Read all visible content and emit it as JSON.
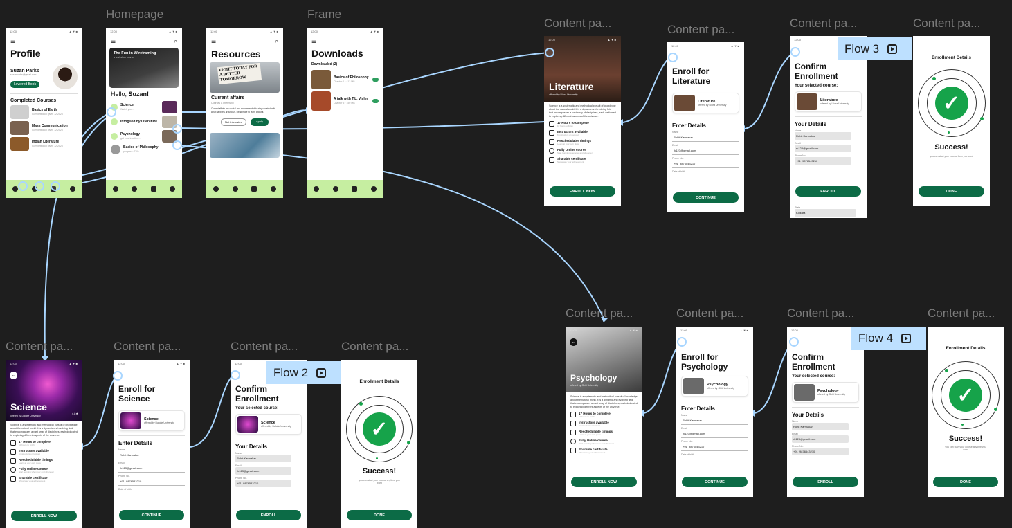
{
  "frame_labels": {
    "profile_label": "",
    "homepage": "Homepage",
    "resources_label": "",
    "frame": "Frame",
    "cp1": "Content pa...",
    "cp2": "Content pa...",
    "cp3": "Content pa...",
    "cp4": "Content pa...",
    "cp5": "Content pa...",
    "cp6": "Content pa...",
    "cp7": "Content pa...",
    "cp8": "Content pa...",
    "cp9": "Content pa...",
    "cp10": "Content pa...",
    "cp11": "Content pa...",
    "cp12": "Content pa..."
  },
  "flows": {
    "flow2": "Flow 2",
    "flow3": "Flow 3",
    "flow4": "Flow 4"
  },
  "status": {
    "time": "12:00",
    "icons": "▲▼■"
  },
  "profile": {
    "title": "Profile",
    "name": "Suzan Parks",
    "email": "suzanparks@gmail.com",
    "badge": "Lowered Book",
    "section": "Completed Courses",
    "courses": [
      {
        "title": "Basics of Earth",
        "sub": "Completed on given 12.2023"
      },
      {
        "title": "Mass Communication",
        "sub": "Completed on given 12.2023"
      },
      {
        "title": "Indian Literature",
        "sub": "Completed on given 12.2023"
      }
    ]
  },
  "homepage": {
    "banner_title": "The Fun in Wireframing",
    "banner_sub": "a workshop course",
    "greeting_prefix": "Hello, ",
    "greeting_name": "Suzan!",
    "items": [
      {
        "title": "Science",
        "sub": "Watch your..."
      },
      {
        "title": "Intrigued by Literature",
        "sub": "take a look..."
      },
      {
        "title": "Psychology",
        "sub": "get your intuition..."
      },
      {
        "title": "Basics of Philosophy",
        "sub": "progress: 72%"
      }
    ]
  },
  "resources": {
    "title": "Resources",
    "poster_text": "FIGHT TODAY FOR A BETTER TOMORROW",
    "section": "Current affairs",
    "sub": "Courses & Internship",
    "body": "Current affairs are crucial and recommended to stay updated with what happens around us. Read more to learn about it.",
    "btn_secondary": "Not interested",
    "btn_primary": "Apply"
  },
  "downloads": {
    "title": "Downloads",
    "section": "Downloaded (2)",
    "items": [
      {
        "title": "Basics of Philosophy",
        "sub": "Chapter 1 · 413 MB"
      },
      {
        "title": "A talk with T.L. Visler",
        "sub": "Chapter 5 · 150 MB"
      }
    ]
  },
  "literature": {
    "hero_title": "Literature",
    "hero_sub": "offered by Lliora University",
    "para": "Science is a systematic and methodical pursuit of knowledge about the natural world. It is a dynamic and evolving field that encompasses a vast array of disciplines, each dedicated to exploring different aspects of the universe.",
    "features": [
      {
        "title": "17 Hours to complete",
        "sub": "10 hours to finish"
      },
      {
        "title": "Instructors available",
        "sub": "6 instructors on lookout"
      },
      {
        "title": "Reschedulable timings",
        "sub": "Learn at your own place"
      },
      {
        "title": "Fully Online course",
        "sub": "Start learning whenever and wherever"
      },
      {
        "title": "Sharable certificate",
        "sub": "Showcase your achievement"
      }
    ],
    "button": "ENROLL NOW"
  },
  "enroll_lit": {
    "title": "Enroll for Literature",
    "course_title": "Literature",
    "course_sub": "offered by Lliora University",
    "section": "Enter Details",
    "name_label": "Name",
    "name_value": "Rohit Karmakar",
    "email_label": "Email",
    "email_value": "rk123@gmail.com",
    "phone_label": "Phone No.",
    "phone_code": "+91",
    "phone_value": "9876543210",
    "extra_label": "Date of birth",
    "button": "CONTINUE"
  },
  "confirm_lit": {
    "title": "Confirm Enrollment",
    "selected": "Your selected course:",
    "course_title": "Literature",
    "course_sub": "offered by Lliora University",
    "section": "Your Details",
    "name_label": "Name",
    "name_value": "Rohit Karmakar",
    "email_label": "Email",
    "email_value": "rk123@gmail.com",
    "phone_label": "Phone No.",
    "phone_code": "+91",
    "phone_value": "9876543210",
    "state_label": "State",
    "state_value": "Kolkata",
    "button": "ENROLL"
  },
  "success_lit": {
    "header": "Enrollment Details",
    "title": "Success!",
    "sub": "you can start your course from you want",
    "button": "DONE"
  },
  "science": {
    "hero_title": "Science",
    "hero_sub": "offered by Daloite University",
    "rating": "4.8★",
    "para": "Science is a systematic and methodical pursuit of knowledge about the natural world. It is a dynamic and evolving field that encompasses a vast array of disciplines, each dedicated to exploring different aspects of the universe.",
    "features": [
      {
        "title": "17 Hours to complete",
        "sub": "10 hours to finish"
      },
      {
        "title": "Instructors available",
        "sub": "6 instructors on lookout"
      },
      {
        "title": "Reschedulable timings",
        "sub": "Learn at your own place"
      },
      {
        "title": "Fully Online course",
        "sub": "Start learning whenever and wherever"
      },
      {
        "title": "Sharable certificate",
        "sub": "Showcase your achievement"
      }
    ],
    "button": "ENROLL NOW"
  },
  "enroll_sci": {
    "title": "Enroll for Science",
    "course_title": "Science",
    "course_sub": "offered by Daloite University",
    "section": "Enter Details",
    "name_label": "Name",
    "name_value": "Rohit Karmakar",
    "email_label": "Email",
    "email_value": "rk123@gmail.com",
    "phone_label": "Phone No.",
    "phone_code": "+91",
    "phone_value": "9876543210",
    "extra_label": "Date of birth",
    "button": "CONTINUE"
  },
  "confirm_sci": {
    "title": "Confirm Enrollment",
    "selected": "Your selected course:",
    "course_title": "Science",
    "course_sub": "offered by Daloite University",
    "section": "Your Details",
    "name_label": "Name",
    "name_value": "Rohit Karmakar",
    "email_label": "Email",
    "email_value": "rk123@gmail.com",
    "phone_label": "Phone No.",
    "phone_code": "+91",
    "phone_value": "9876543210",
    "button": "ENROLL"
  },
  "success_sci": {
    "header": "Enrollment Details",
    "title": "Success!",
    "sub": "you can start your course anytime you want",
    "button": "DONE"
  },
  "psychology": {
    "hero_title": "Psychology",
    "hero_sub": "offered by Ghiti University",
    "para": "Science is a systematic and methodical pursuit of knowledge about the natural world. It is a dynamic and evolving field that encompasses a vast array of disciplines, each dedicated to exploring different aspects of the universe.",
    "features": [
      {
        "title": "17 Hours to complete",
        "sub": "10 hours to finish"
      },
      {
        "title": "Instructors available",
        "sub": "6 instructors on lookout"
      },
      {
        "title": "Reschedulable timings",
        "sub": "Learn at your own place"
      },
      {
        "title": "Fully Online course",
        "sub": "Start learning whenever and wherever"
      },
      {
        "title": "Sharable certificate",
        "sub": "Showcase your achievement"
      }
    ],
    "button": "ENROLL NOW"
  },
  "enroll_psy": {
    "title": "Enroll for Psychology",
    "course_title": "Psychology",
    "course_sub": "offered by Ghiti University",
    "section": "Enter Details",
    "name_label": "Name",
    "name_value": "Rohit Karmakar",
    "email_label": "Email",
    "email_value": "rk123@gmail.com",
    "phone_label": "Phone No.",
    "phone_code": "+91",
    "phone_value": "9876543210",
    "extra_label": "Date of birth",
    "button": "CONTINUE"
  },
  "confirm_psy": {
    "title": "Confirm Enrollment",
    "selected": "Your selected course:",
    "course_title": "Psychology",
    "course_sub": "offered by Ghiti University",
    "section": "Your Details",
    "name_label": "Name",
    "name_value": "Rohit Karmakar",
    "email_label": "Email",
    "email_value": "rk123@gmail.com",
    "phone_label": "Phone No.",
    "phone_code": "+91",
    "phone_value": "9876543210",
    "button": "ENROLL"
  },
  "success_psy": {
    "header": "Enrollment Details",
    "title": "Success!",
    "sub": "you can start your course anytime you want",
    "button": "DONE"
  },
  "colors": {
    "canvas": "#1e1e1e",
    "primary_green": "#0c6b46",
    "nav_green": "#c6eea1",
    "success_green": "#16a34a",
    "connector": "#a9d6ff",
    "flow_tag": "#bde0ff"
  }
}
